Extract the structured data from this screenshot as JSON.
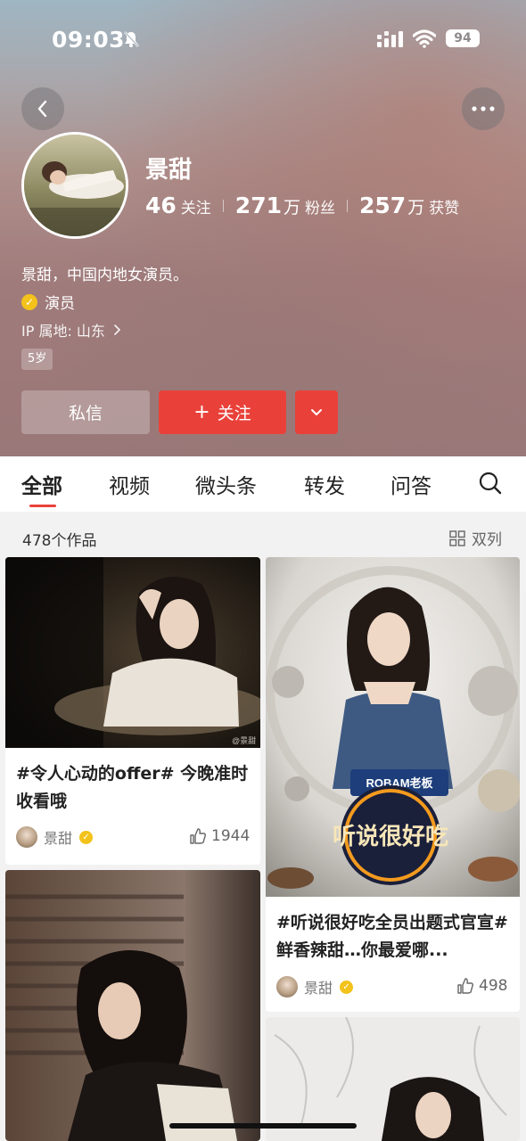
{
  "status_bar": {
    "time": "09:03",
    "battery": "94"
  },
  "profile": {
    "name": "景甜",
    "stats": [
      {
        "num": "46",
        "unit": "",
        "label": "关注"
      },
      {
        "num": "271",
        "unit": "万",
        "label": "粉丝"
      },
      {
        "num": "257",
        "unit": "万",
        "label": "获赞"
      }
    ],
    "bio": "景甜，中国内地女演员。",
    "role": "演员",
    "ip": "IP 属地: 山东",
    "age_tag": "5岁"
  },
  "actions": {
    "message": "私信",
    "follow": "关注"
  },
  "tabs": [
    "全部",
    "视频",
    "微头条",
    "转发",
    "问答"
  ],
  "works": {
    "count": "478个作品",
    "layout_toggle": "双列"
  },
  "cards": [
    {
      "title": "#令人心动的offer# 今晚准时收看哦",
      "author": "景甜",
      "likes": "1944",
      "watermark": "@景甜"
    },
    {
      "title": "#听说很好吃全员出题式官宣# 鲜香辣甜…你最爱哪...",
      "author": "景甜",
      "likes": "498",
      "poster_brand": "ROBAM老板",
      "poster_show": "听说很好吃"
    }
  ],
  "colors": {
    "accent": "#e9413a",
    "verified": "#f3c21b"
  }
}
